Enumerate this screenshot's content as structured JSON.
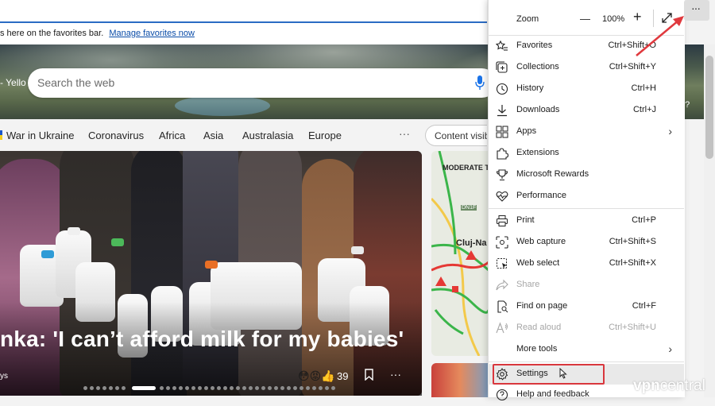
{
  "favorites_bar": {
    "text": "s here on the favorites bar.",
    "link": "Manage favorites now"
  },
  "hero": {
    "label": "- Yello",
    "question": "d?"
  },
  "search": {
    "placeholder": "Search the web"
  },
  "nav": {
    "items": [
      "War in Ukraine",
      "Coronavirus",
      "Africa",
      "Asia",
      "Australasia",
      "Europe"
    ],
    "more": "···",
    "content_visibility": "Content visib"
  },
  "main_card": {
    "headline": "nka: 'I can’t afford milk for my babies'",
    "source": "ys",
    "reactions": "😳😡👍",
    "reaction_count": "39",
    "more": "···"
  },
  "map_card": {
    "label": "MODERATE T",
    "city": "Cluj-Na",
    "road": "DN1F"
  },
  "menu": {
    "zoom_label": "Zoom",
    "zoom_minus": "—",
    "zoom_value": "100%",
    "zoom_plus": "+",
    "items": [
      {
        "label": "Favorites",
        "shortcut": "Ctrl+Shift+O"
      },
      {
        "label": "Collections",
        "shortcut": "Ctrl+Shift+Y"
      },
      {
        "label": "History",
        "shortcut": "Ctrl+H"
      },
      {
        "label": "Downloads",
        "shortcut": "Ctrl+J"
      },
      {
        "label": "Apps",
        "shortcut": ""
      },
      {
        "label": "Extensions",
        "shortcut": ""
      },
      {
        "label": "Microsoft Rewards",
        "shortcut": ""
      },
      {
        "label": "Performance",
        "shortcut": ""
      },
      {
        "label": "Print",
        "shortcut": "Ctrl+P"
      },
      {
        "label": "Web capture",
        "shortcut": "Ctrl+Shift+S"
      },
      {
        "label": "Web select",
        "shortcut": "Ctrl+Shift+X"
      },
      {
        "label": "Share",
        "shortcut": ""
      },
      {
        "label": "Find on page",
        "shortcut": "Ctrl+F"
      },
      {
        "label": "Read aloud",
        "shortcut": "Ctrl+Shift+U"
      },
      {
        "label": "More tools",
        "shortcut": ""
      },
      {
        "label": "Settings",
        "shortcut": ""
      },
      {
        "label": "Help and feedback",
        "shortcut": ""
      }
    ]
  },
  "toolbar": {
    "more_button": "···"
  },
  "watermark": {
    "text": "vpn",
    "text2": "central"
  },
  "colors": {
    "accent": "#2b6cc4",
    "highlight_box": "#d9373d",
    "arrow": "#e0393e"
  }
}
